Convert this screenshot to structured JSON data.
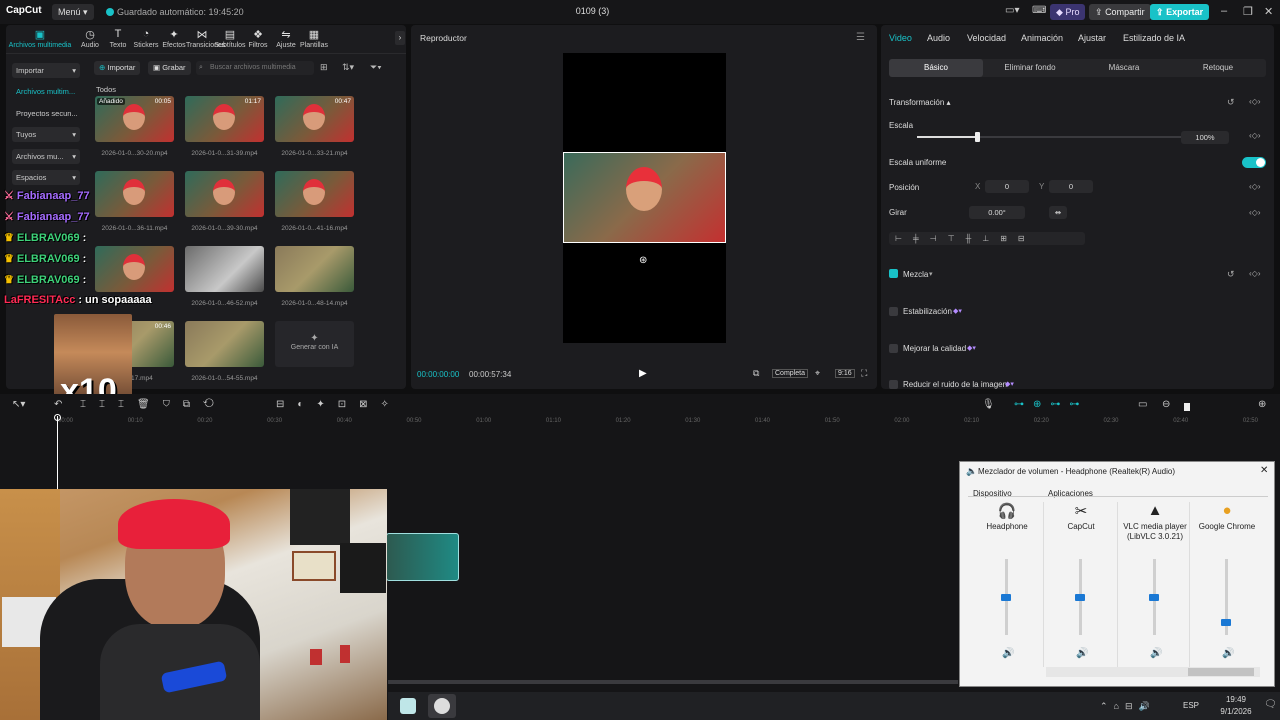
{
  "titlebar": {
    "logo": "CapCut",
    "menu_label": "Menú",
    "autosave": "Guardado automático: 19:45:20",
    "project_title": "0109 (3)",
    "pro_label": "Pro",
    "share_label": "Compartir",
    "export_label": "Exportar"
  },
  "media_tabs": [
    {
      "label": "Archivos multimedia",
      "icon": "media-icon"
    },
    {
      "label": "Audio",
      "icon": "audio-icon"
    },
    {
      "label": "Texto",
      "icon": "text-icon"
    },
    {
      "label": "Stickers",
      "icon": "sticker-icon"
    },
    {
      "label": "Efectos",
      "icon": "effects-icon"
    },
    {
      "label": "Transiciones",
      "icon": "transitions-icon"
    },
    {
      "label": "Subtítulos",
      "icon": "subtitles-icon"
    },
    {
      "label": "Filtros",
      "icon": "filters-icon"
    },
    {
      "label": "Ajuste",
      "icon": "adjust-icon"
    },
    {
      "label": "Plantillas",
      "icon": "templates-icon"
    }
  ],
  "media_sidebar": [
    {
      "label": "Importar"
    },
    {
      "label": "Archivos multim..."
    },
    {
      "label": "Proyectos secun..."
    },
    {
      "label": "Tuyos"
    },
    {
      "label": "Archivos mu..."
    },
    {
      "label": "Espacios"
    }
  ],
  "media_toolbar": {
    "import_label": "Importar",
    "record_label": "Grabar",
    "search_placeholder": "Buscar archivos multimedia",
    "section_label": "Todos"
  },
  "media_items": [
    {
      "name": "2026-01-0...30-20.mp4",
      "duration": "00:05",
      "badge": "Añadido",
      "kind": "face"
    },
    {
      "name": "2026-01-0...31-39.mp4",
      "duration": "01:17",
      "badge": "",
      "kind": "face"
    },
    {
      "name": "2026-01-0...33-21.mp4",
      "duration": "00:47",
      "badge": "",
      "kind": "face"
    },
    {
      "name": "2026-01-0...36-11.mp4",
      "duration": "",
      "badge": "",
      "kind": "face"
    },
    {
      "name": "2026-01-0...39-30.mp4",
      "duration": "",
      "badge": "",
      "kind": "face"
    },
    {
      "name": "2026-01-0...41-16.mp4",
      "duration": "",
      "badge": "",
      "kind": "face"
    },
    {
      "name": "",
      "duration": "",
      "badge": "",
      "kind": "face"
    },
    {
      "name": "2026-01-0...46-52.mp4",
      "duration": "",
      "badge": "",
      "kind": "car"
    },
    {
      "name": "2026-01-0...48-14.mp4",
      "duration": "",
      "badge": "",
      "kind": "out"
    },
    {
      "name": "...53-17.mp4",
      "duration": "00:46",
      "badge": "",
      "kind": "out"
    },
    {
      "name": "2026-01-0...54-55.mp4",
      "duration": "",
      "badge": "",
      "kind": "out"
    },
    {
      "name": "Generar con IA",
      "duration": "",
      "badge": "",
      "kind": "gen"
    }
  ],
  "chat_overlay": [
    {
      "user": "Fabianaap_77",
      "msg": "",
      "color": "#a56bff"
    },
    {
      "user": "Fabianaap_77",
      "msg": "",
      "color": "#a56bff"
    },
    {
      "user": "ELBRAV069",
      "msg": ":",
      "color": "#3ed27a"
    },
    {
      "user": "ELBRAV069",
      "msg": ":",
      "color": "#3ed27a"
    },
    {
      "user": "ELBRAV069",
      "msg": ":",
      "color": "#3ed27a"
    },
    {
      "user": "LaFRESITAcc",
      "msg": ": un sopaaaaa",
      "color": "#ff2b55"
    }
  ],
  "emote_text": "x10",
  "player": {
    "title": "Reproductor",
    "current_time": "00:00:00:00",
    "total_time": "00:00:57:34",
    "ratio_label": "Completa",
    "aspect_label": "9:16"
  },
  "props": {
    "tabs": [
      "Video",
      "Audio",
      "Velocidad",
      "Animación",
      "Ajustar",
      "Estilizado de IA"
    ],
    "subtabs": [
      "Básico",
      "Eliminar fondo",
      "Máscara",
      "Retoque"
    ],
    "transform_label": "Transformación",
    "scale_label": "Escala",
    "scale_value": "100%",
    "uniform_label": "Escala uniforme",
    "position_label": "Posición",
    "pos_x_label": "X",
    "pos_x": "0",
    "pos_y_label": "Y",
    "pos_y": "0",
    "rotate_label": "Girar",
    "rotate_value": "0.00°",
    "blend_label": "Mezcla",
    "stab_label": "Estabilización",
    "quality_label": "Mejorar la calidad",
    "noise_label": "Reducir el ruido de la imagen"
  },
  "timeline_ticks": [
    "00:00",
    "00:10",
    "00:20",
    "00:30",
    "00:40",
    "00:50",
    "01:00",
    "01:10",
    "01:20",
    "01:30",
    "01:40",
    "01:50",
    "02:00",
    "02:10",
    "02:20",
    "02:30",
    "02:40",
    "02:50"
  ],
  "mixer": {
    "title": "Mezclador de volumen - Headphone (Realtek(R) Audio)",
    "device_label": "Dispositivo",
    "apps_label": "Aplicaciones",
    "channels": [
      {
        "name": "Headphone",
        "level": 0.5,
        "icon": "headphone-icon"
      },
      {
        "name": "CapCut",
        "level": 0.5,
        "icon": "capcut-icon"
      },
      {
        "name": "VLC media player (LibVLC 3.0.21)",
        "level": 0.5,
        "icon": "vlc-icon"
      },
      {
        "name": "Google Chrome",
        "level": 0.15,
        "icon": "chrome-icon"
      }
    ]
  },
  "taskbar": {
    "lang": "ESP",
    "time": "19:49",
    "date": "9/1/2026"
  }
}
